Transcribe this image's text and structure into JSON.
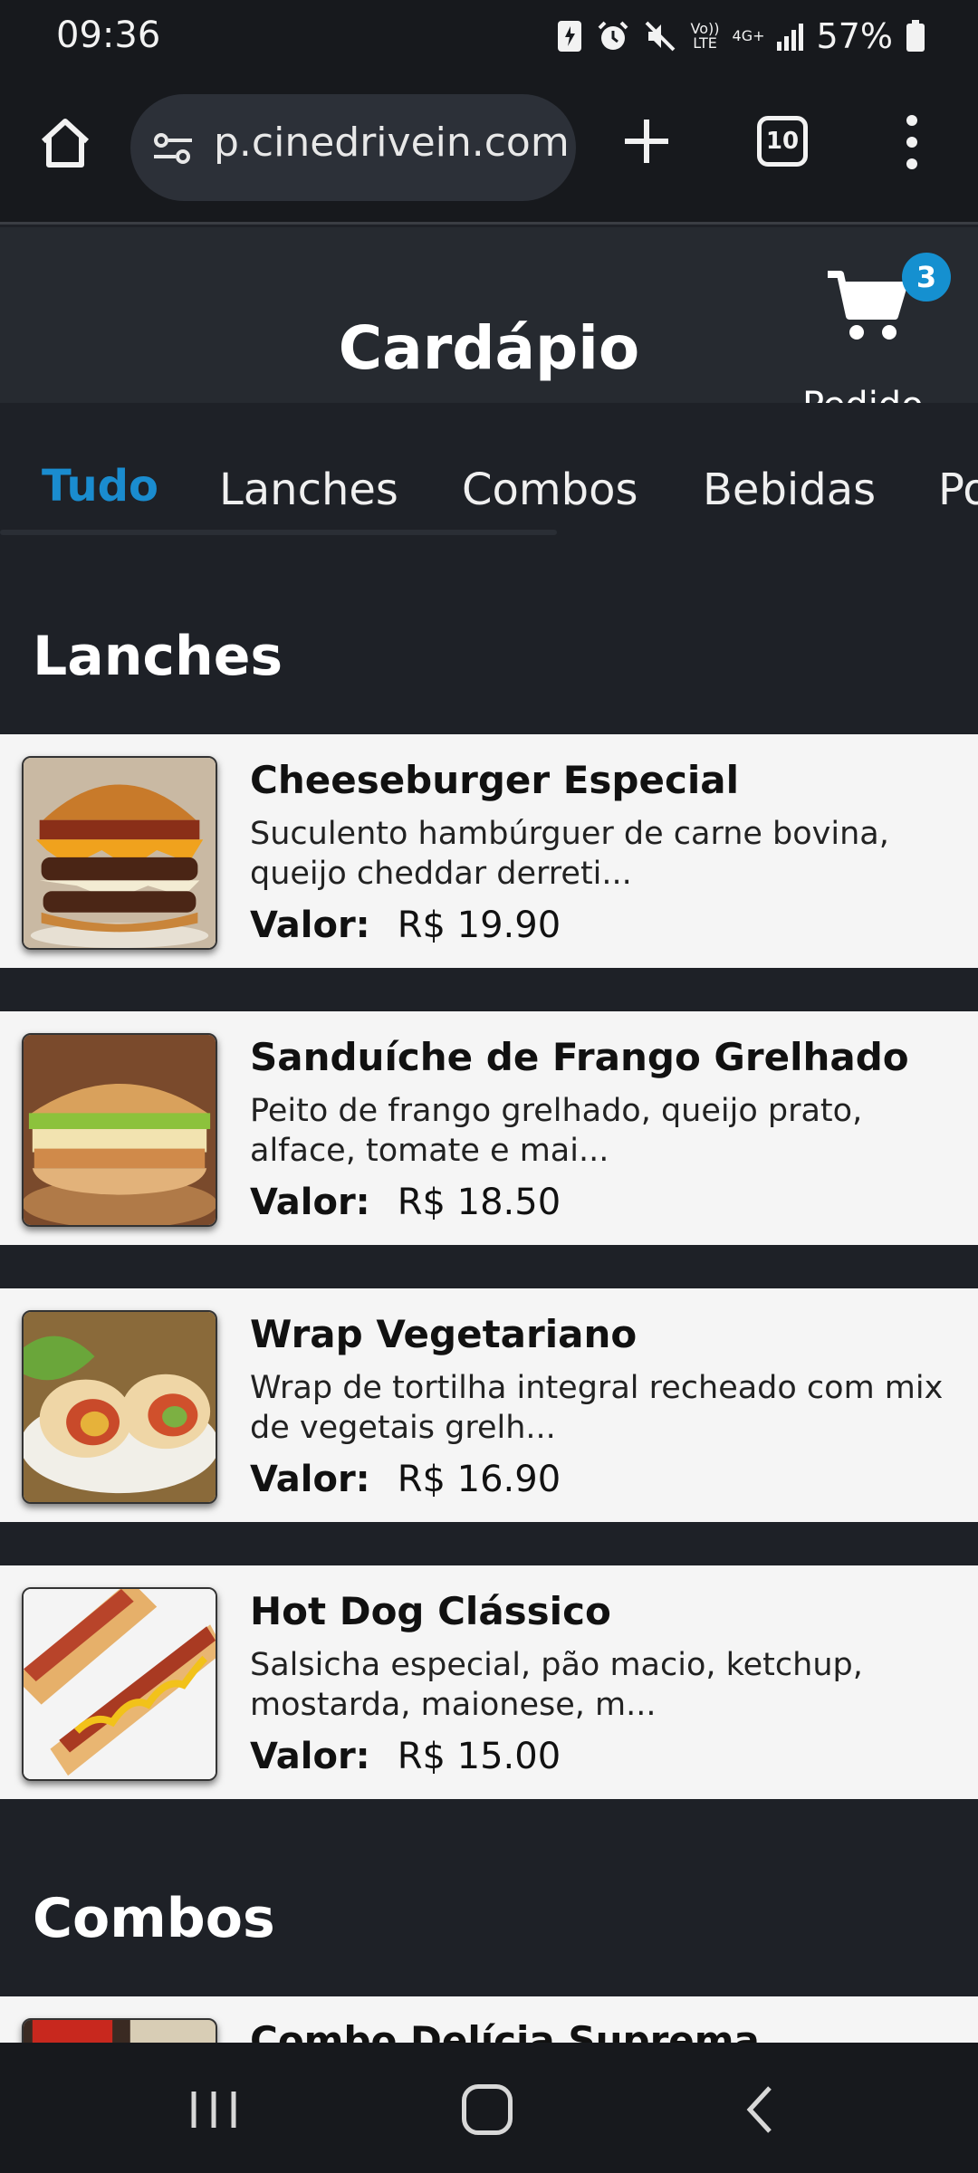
{
  "status_bar": {
    "time": "09:36",
    "volte": "Vo)) LTE",
    "network": "4G+",
    "battery": "57%"
  },
  "browser": {
    "url": "p.cinedrivein.com",
    "tab_count": "10"
  },
  "header": {
    "title": "Cardápio",
    "cart_label": "Pedido",
    "cart_count": "3"
  },
  "category_tabs": [
    {
      "label": "Tudo",
      "active": true
    },
    {
      "label": "Lanches",
      "active": false
    },
    {
      "label": "Combos",
      "active": false
    },
    {
      "label": "Bebidas",
      "active": false
    },
    {
      "label": "Po",
      "active": false
    }
  ],
  "sections": [
    {
      "title": "Lanches",
      "items": [
        {
          "name": "Cheeseburger Especial",
          "description": "Suculento hambúrguer de carne bovina, queijo cheddar derreti...",
          "price_label": "Valor:",
          "price": "R$ 19.90"
        },
        {
          "name": "Sanduíche de Frango Grelhado",
          "description": "Peito de frango grelhado, queijo prato, alface, tomate e mai...",
          "price_label": "Valor:",
          "price": "R$ 18.50"
        },
        {
          "name": "Wrap Vegetariano",
          "description": "Wrap de tortilha integral recheado com mix de vegetais grelh...",
          "price_label": "Valor:",
          "price": "R$ 16.90"
        },
        {
          "name": "Hot Dog Clássico",
          "description": "Salsicha especial, pão macio, ketchup, mostarda, maionese, m...",
          "price_label": "Valor:",
          "price": "R$ 15.00"
        }
      ]
    },
    {
      "title": "Combos",
      "items": [
        {
          "name": "Combo Delícia Suprema"
        }
      ]
    }
  ],
  "colors": {
    "accent": "#1a8ccf",
    "badge": "#1590d0",
    "background": "#1e2127",
    "card": "#f5f5f5"
  }
}
